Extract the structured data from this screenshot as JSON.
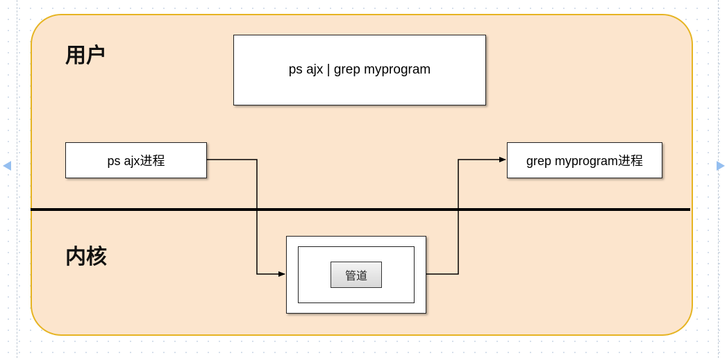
{
  "sections": {
    "user_label": "用户",
    "kernel_label": "内核"
  },
  "command": {
    "text": "ps  ajx | grep myprogram"
  },
  "processes": {
    "left": "ps  ajx进程",
    "right": "grep myprogram进程"
  },
  "pipe": {
    "label": "管道"
  }
}
